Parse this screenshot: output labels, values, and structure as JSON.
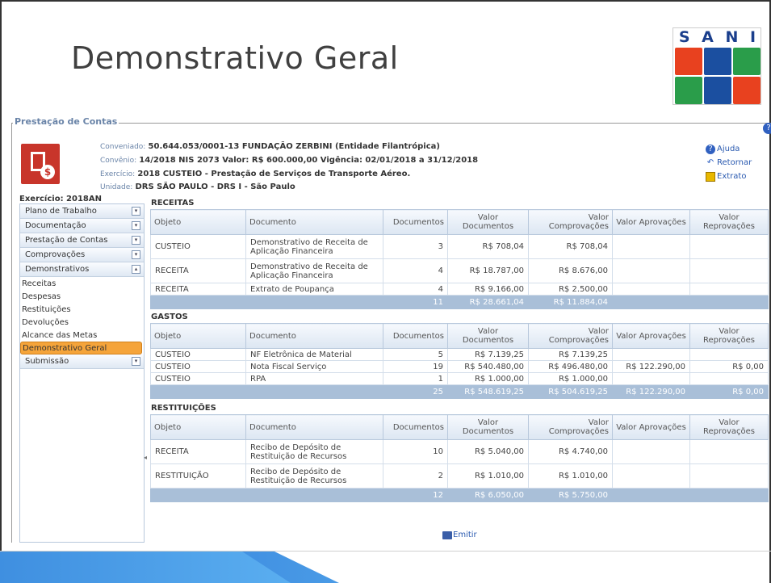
{
  "slide": {
    "title": "Demonstrativo Geral"
  },
  "logo": {
    "letters": [
      "S",
      "A",
      "N",
      "I"
    ]
  },
  "section": {
    "legend": "Prestação de Contas"
  },
  "header": {
    "conveniado_label": "Conveniado:",
    "conveniado_value": "50.644.053/0001-13  FUNDAÇÃO ZERBINI  (Entidade Filantrópica)",
    "convenio_label": "Convênio:",
    "convenio_value": "14/2018 NIS 2073 Valor: R$ 600.000,00 Vigência: 02/01/2018 a 31/12/2018",
    "exercicio_label": "Exercício:",
    "exercicio_value": "2018  CUSTEIO - Prestação de Serviços de Transporte Aéreo.",
    "unidade_label": "Unidade:",
    "unidade_value": "DRS SÃO PAULO - DRS I - São Paulo"
  },
  "side_links": {
    "ajuda": "Ajuda",
    "retornar": "Retornar",
    "extrato": "Extrato"
  },
  "sidebar": {
    "exercicio": "Exercício: 2018AN",
    "items": [
      {
        "label": "Plano de Trabalho",
        "toggle": "▾"
      },
      {
        "label": "Documentação",
        "toggle": "▾"
      },
      {
        "label": "Prestação de Contas",
        "toggle": "▾"
      },
      {
        "label": "Comprovações",
        "toggle": "▾"
      },
      {
        "label": "Demonstrativos",
        "toggle": "▴"
      }
    ],
    "subitems": [
      "Receitas",
      "Despesas",
      "Restituições",
      "Devoluções",
      "Alcance das Metas",
      "Demonstrativo Geral"
    ],
    "last_item": {
      "label": "Submissão",
      "toggle": "▾"
    }
  },
  "columns": {
    "objeto": "Objeto",
    "documento": "Documento",
    "documentos": "Documentos",
    "valor_documentos": "Valor Documentos",
    "valor_comprovacoes": "Valor Comprovações",
    "valor_aprovacoes": "Valor Aprovações",
    "valor_reprovacoes": "Valor Reprovações"
  },
  "receitas": {
    "title": "RECEITAS",
    "rows": [
      [
        "CUSTEIO",
        "Demonstrativo de Receita de Aplicação Financeira",
        "3",
        "R$ 708,04",
        "R$ 708,04",
        "",
        ""
      ],
      [
        "RECEITA",
        "Demonstrativo de Receita de Aplicação Financeira",
        "4",
        "R$ 18.787,00",
        "R$ 8.676,00",
        "",
        ""
      ],
      [
        "RECEITA",
        "Extrato de Poupança",
        "4",
        "R$ 9.166,00",
        "R$ 2.500,00",
        "",
        ""
      ]
    ],
    "total": [
      "",
      "",
      "11",
      "R$ 28.661,04",
      "R$ 11.884,04",
      "",
      ""
    ]
  },
  "gastos": {
    "title": "GASTOS",
    "rows": [
      [
        "CUSTEIO",
        "NF Eletrônica de Material",
        "5",
        "R$ 7.139,25",
        "R$ 7.139,25",
        "",
        ""
      ],
      [
        "CUSTEIO",
        "Nota Fiscal Serviço",
        "19",
        "R$ 540.480,00",
        "R$ 496.480,00",
        "R$ 122.290,00",
        "R$ 0,00"
      ],
      [
        "CUSTEIO",
        "RPA",
        "1",
        "R$ 1.000,00",
        "R$ 1.000,00",
        "",
        ""
      ]
    ],
    "total": [
      "",
      "",
      "25",
      "R$ 548.619,25",
      "R$ 504.619,25",
      "R$ 122.290,00",
      "R$ 0,00"
    ]
  },
  "restituicoes": {
    "title": "RESTITUIÇÕES",
    "rows": [
      [
        "RECEITA",
        "Recibo de Depósito de Restituição de Recursos",
        "10",
        "R$ 5.040,00",
        "R$ 4.740,00",
        "",
        ""
      ],
      [
        "RESTITUIÇÃO",
        "Recibo de Depósito de Restituição de Recursos",
        "2",
        "R$ 1.010,00",
        "R$ 1.010,00",
        "",
        ""
      ]
    ],
    "total": [
      "",
      "",
      "12",
      "R$ 6.050,00",
      "R$ 5.750,00",
      "",
      ""
    ]
  },
  "actions": {
    "emitir": "Emitir"
  },
  "colors": {
    "logo_cells": [
      "#e8411f",
      "#1b4fa0",
      "#2a9d4a",
      "#2a9d4a",
      "#1b4fa0",
      "#e8411f"
    ],
    "active_menu": "#f5a43a",
    "total_row": "#a9bfd8",
    "link": "#2a5ab0"
  }
}
